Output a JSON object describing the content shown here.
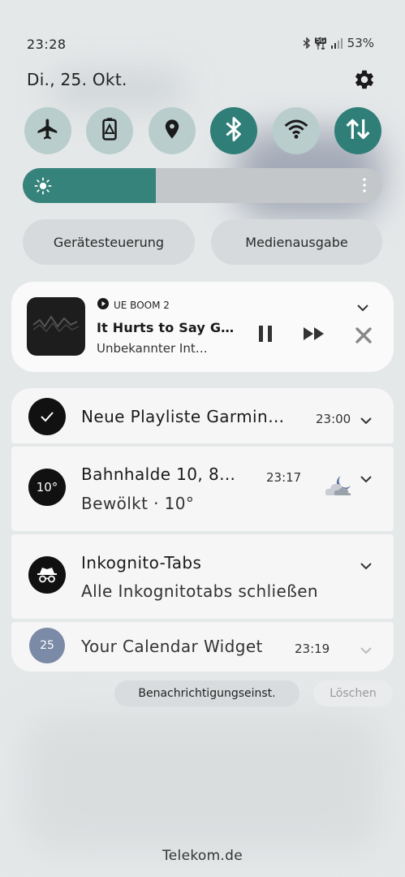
{
  "status_bar": {
    "time": "23:28",
    "network": "5G",
    "battery": "53%"
  },
  "header": {
    "date": "Di., 25. Okt."
  },
  "quick_settings": [
    {
      "name": "airplane-mode",
      "icon": "airplane-icon",
      "active": false
    },
    {
      "name": "power-saving",
      "icon": "battery-saver-icon",
      "active": false
    },
    {
      "name": "location",
      "icon": "location-pin-icon",
      "active": false
    },
    {
      "name": "bluetooth",
      "icon": "bluetooth-icon",
      "active": true
    },
    {
      "name": "wifi",
      "icon": "wifi-icon",
      "active": false
    },
    {
      "name": "mobile-data",
      "icon": "data-arrows-icon",
      "active": true
    }
  ],
  "brightness": {
    "level": 0.37
  },
  "pills": {
    "device_control": "Gerätesteuerung",
    "media_output": "Medienausgabe"
  },
  "media": {
    "source": "UE BOOM 2",
    "title": "It Hurts to Say G…",
    "artist": "Unbekannter Int…"
  },
  "notifications": [
    {
      "title": "Neue Playliste Garmin…",
      "time": "23:00",
      "icon": "check-icon"
    },
    {
      "title": "Bahnhalde 10, 8…",
      "time": "23:17",
      "text": "Bewölkt · 10°",
      "avatar_text": "10°",
      "icon": "cloudy-night-icon"
    },
    {
      "title": "Inkognito-Tabs",
      "text": "Alle Inkognitotabs schließen",
      "icon": "incognito-icon"
    },
    {
      "title": "Your Calendar Widget",
      "time": "23:19",
      "avatar_text": "25"
    }
  ],
  "actions": {
    "settings": "Benachrichtigungseinst.",
    "clear": "Löschen"
  },
  "carrier": "Telekom.de",
  "colors": {
    "accent": "#2f7e78",
    "tile_inactive": "#b9cdcd",
    "calendar_avatar": "#7b8aa6"
  }
}
